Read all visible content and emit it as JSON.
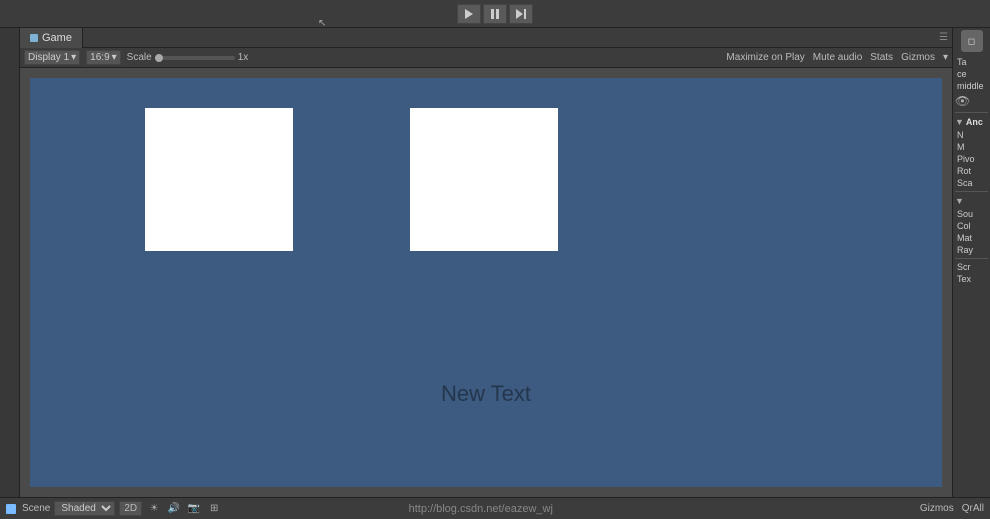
{
  "toolbar": {
    "play_label": "▶",
    "pause_label": "⏸",
    "step_label": "⏭"
  },
  "game_panel": {
    "tab_label": "Game",
    "tab_options": "☰",
    "display_label": "Display 1",
    "aspect_label": "16:9",
    "scale_label": "Scale",
    "scale_value": "1x",
    "maximize_label": "Maximize on Play",
    "mute_label": "Mute audio",
    "stats_label": "Stats",
    "gizmos_label": "Gizmos",
    "canvas_text": "New Text"
  },
  "inspector": {
    "tab_label": "Ta",
    "section_ce": "ce",
    "middle_label": "middle",
    "anchor_label": "Anc",
    "n_label": "N",
    "m_label": "M",
    "pivot_label": "Pivo",
    "rotation_label": "Rot",
    "scale_label2": "Sca",
    "source_label": "Sou",
    "color_label": "Col",
    "material_label": "Mat",
    "raycast_label": "Ray",
    "script_label": "Scr",
    "text_label": "Tex"
  },
  "bottom_bar": {
    "scene_label": "Scene",
    "shaded_label": "Shaded",
    "mode_2d": "2D",
    "url_text": "http://blog.csdn.net/eazew_wj",
    "gizmos_label": "Gizmos",
    "qall_label": "QrAll"
  }
}
